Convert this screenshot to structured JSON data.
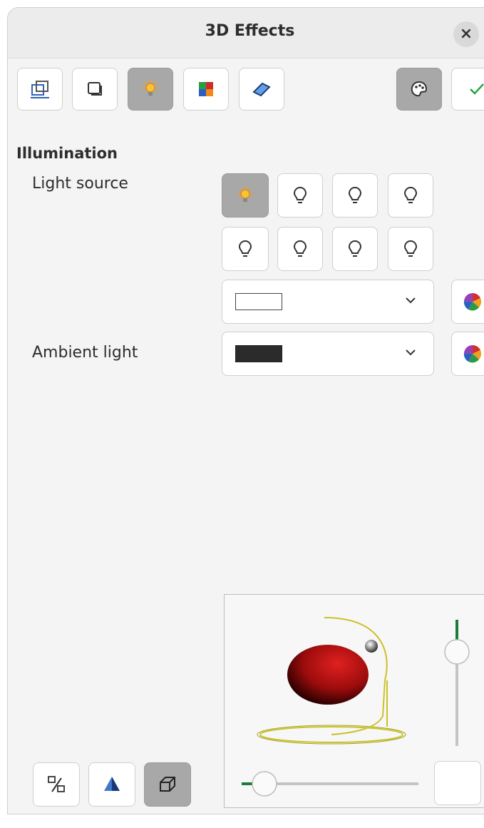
{
  "window": {
    "title": "3D Effects",
    "close_glyph": "×"
  },
  "toolbar": {
    "buttons": [
      {
        "name": "geometry",
        "icon": "geometry-icon",
        "active": false
      },
      {
        "name": "shading",
        "icon": "shading-icon",
        "active": false
      },
      {
        "name": "illumination",
        "icon": "illumination-icon",
        "active": true
      },
      {
        "name": "textures",
        "icon": "textures-icon",
        "active": false
      },
      {
        "name": "material",
        "icon": "material-icon",
        "active": false
      }
    ],
    "right_buttons": [
      {
        "name": "assign-attributes",
        "icon": "palette-icon",
        "active": true
      },
      {
        "name": "apply",
        "icon": "checkmark-icon",
        "active": false
      }
    ]
  },
  "illumination": {
    "section_label": "Illumination",
    "light_source_label": "Light source",
    "ambient_light_label": "Ambient light",
    "light_source_selected": 1,
    "light_source_color": "#ffffff",
    "ambient_light_color": "#2b2b2b"
  },
  "bottom_buttons": [
    {
      "name": "convert-to-3d",
      "icon": "convert-3d-icon",
      "active": false
    },
    {
      "name": "convert-to-lathe",
      "icon": "lathe-icon",
      "active": false
    },
    {
      "name": "perspective",
      "icon": "perspective-icon",
      "active": true
    }
  ],
  "colors": {
    "accent_green": "#1f7a3a",
    "sphere_red": "#c41313",
    "ring_yellow": "#c9c22a"
  }
}
